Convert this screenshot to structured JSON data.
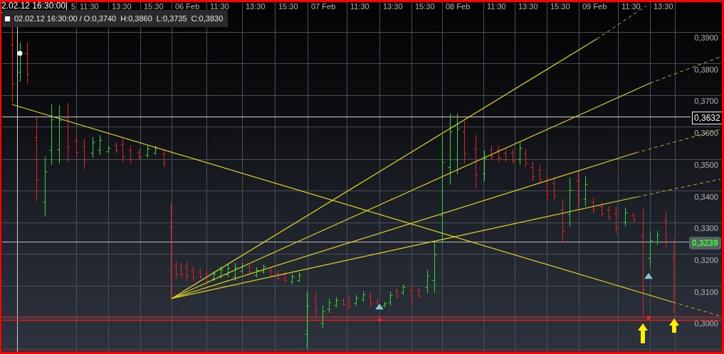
{
  "time_axis": {
    "cursor_label": "2.02.12 16:30:00",
    "labels": [
      "5",
      "11:30",
      "13:30",
      "15:30",
      "06 Feb",
      "11:30",
      "13:30",
      "15:30",
      "07 Feb",
      "11:30",
      "13:30",
      "15:30",
      "08 Feb",
      "11:30",
      "13:30",
      "15:30",
      "09 Feb",
      "11:30",
      "13:30"
    ]
  },
  "ohlc_info": {
    "time_open": "02.02.12 16:30:00 / O:0,3740",
    "high": "H:0,3860",
    "low": "L:0,3735",
    "close": "C:0,3830"
  },
  "price_axis": {
    "labels": [
      "0,3900",
      "0,3800",
      "0,3700",
      "0,3600",
      "0,3500",
      "0,3400",
      "0,3300",
      "0,3200",
      "0,3100",
      "0,3000"
    ],
    "crosshair_price": "0,3632",
    "last_price": "0,3239"
  }
}
